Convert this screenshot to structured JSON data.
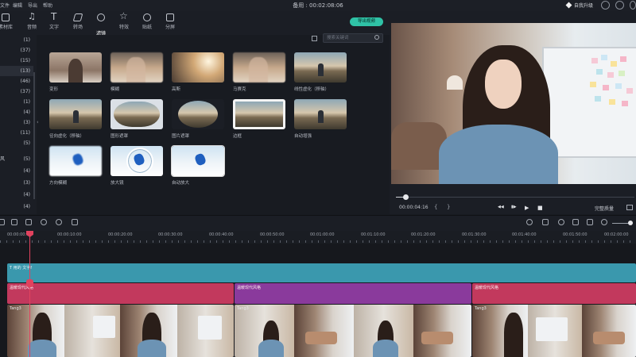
{
  "titlebar": {
    "menu": [
      "文件",
      "编辑",
      "导出",
      "帮助"
    ],
    "title": "备用 : 00:02:08:06",
    "upgrade_label": "自我升级"
  },
  "toolbar": {
    "tabs": [
      {
        "label": "素材库",
        "icon": "folder-icon"
      },
      {
        "label": "音频",
        "icon": "music-note-icon"
      },
      {
        "label": "文字",
        "icon": "text-icon"
      },
      {
        "label": "转场",
        "icon": "transition-icon"
      },
      {
        "label": "滤镜",
        "icon": "filter-icon",
        "active": true
      },
      {
        "label": "特效",
        "icon": "effects-star-icon"
      },
      {
        "label": "贴纸",
        "icon": "sticker-icon"
      },
      {
        "label": "分屏",
        "icon": "split-screen-icon"
      }
    ],
    "export_label": "导出视频"
  },
  "categories": [
    {
      "left": "",
      "count": "(1)"
    },
    {
      "left": "",
      "count": "(37)"
    },
    {
      "left": "",
      "count": "(15)"
    },
    {
      "left": "",
      "count": "(13)",
      "active": true
    },
    {
      "left": "",
      "count": "(46)"
    },
    {
      "left": "",
      "count": "(37)"
    },
    {
      "left": "",
      "count": "(1)"
    },
    {
      "left": "",
      "count": "(4)"
    },
    {
      "left": "",
      "count": "(3)"
    },
    {
      "left": "",
      "count": "(11)"
    },
    {
      "left": "",
      "count": "(5)"
    },
    {
      "left": "风",
      "count": "(5)"
    },
    {
      "left": "",
      "count": "(4)"
    },
    {
      "left": "",
      "count": "(3)"
    },
    {
      "left": "",
      "count": "(4)"
    },
    {
      "left": "",
      "count": "(4)"
    }
  ],
  "search": {
    "placeholder": "搜索关键词"
  },
  "effects": [
    {
      "name": "变形"
    },
    {
      "name": "模糊"
    },
    {
      "name": "高斯"
    },
    {
      "name": "马赛克"
    },
    {
      "name": "线性虚化（移轴）"
    },
    {
      "name": "径向虚化（移轴）"
    },
    {
      "name": "图形遮罩"
    },
    {
      "name": "图片遮罩"
    },
    {
      "name": "边框"
    },
    {
      "name": "自动增强"
    },
    {
      "name": "方向模糊"
    },
    {
      "name": "放大镜"
    },
    {
      "name": "自动放大"
    }
  ],
  "player": {
    "timecode": "00:00:04:16",
    "bracket_in": "{",
    "bracket_out": "}",
    "prev": "◀◀",
    "step": "▮▶",
    "play": "▶",
    "stop": "■",
    "quality_label": "完整质量",
    "progress": 0.04
  },
  "ruler": {
    "ticks": [
      "00:00:00:00",
      "00:00:10:00",
      "00:00:20:00",
      "00:00:30:00",
      "00:00:40:00",
      "00:00:50:00",
      "00:01:00:00",
      "00:01:10:00",
      "00:01:20:00",
      "00:01:30:00",
      "00:01:40:00",
      "00:01:50:00",
      "00:02:00:00"
    ]
  },
  "tracks": {
    "title_clip": "T 用的 文字f",
    "pink_clips": [
      "温暖现代风格",
      "温暖现代风格",
      "温暖现代风格"
    ],
    "video_clips": [
      "Tang3",
      "Tang3",
      "Tang3"
    ]
  },
  "colors": {
    "accent": "#2fc2a6",
    "playhead": "#e1425e",
    "title_track": "#3a98ad",
    "pink_track": "#c2395d",
    "purple_track": "#8a3a9c"
  }
}
